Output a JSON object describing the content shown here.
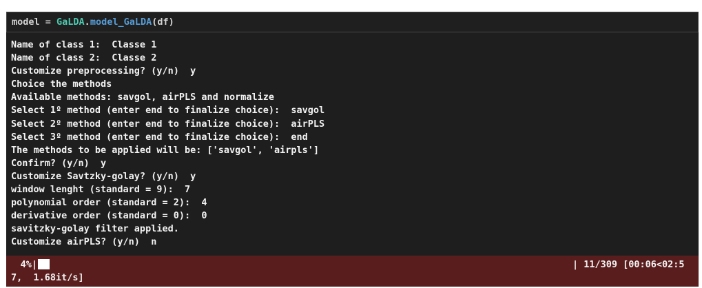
{
  "cell": {
    "code": {
      "var": "model",
      "op": " = ",
      "module": "GaLDA",
      "dot": ".",
      "func": "model_GaLDA",
      "args": "(df)"
    }
  },
  "output": {
    "lines": [
      "Name of class 1:  Classe 1",
      "Name of class 2:  Classe 2",
      "Customize preprocessing? (y/n)  y",
      "Choice the methods",
      "Available methods: savgol, airPLS and normalize",
      "Select 1º method (enter end to finalize choice):  savgol",
      "Select 2º method (enter end to finalize choice):  airPLS",
      "Select 3º method (enter end to finalize choice):  end",
      "The methods to be applied will be: ['savgol', 'airpls']",
      "Confirm? (y/n)  y",
      "Customize Savtzky-golay? (y/n)  y",
      "window lenght (standard = 9):  7",
      "polynomial order (standard = 2):  4",
      "derivative order (standard = 0):  0",
      "savitzky-golay filter applied.",
      "Customize airPLS? (y/n)  n"
    ]
  },
  "progress": {
    "percent_text": "4%|",
    "fraction": 0.04,
    "stats_right": "| 11/309 [00:06<02:5",
    "stats_wrap": "7,  1.68it/s]"
  },
  "colors": {
    "background": "#1e1e1e",
    "stderr_background": "#5a1d1d",
    "module_color": "#4ec9b0",
    "function_color": "#569cd6",
    "text": "#f2f2f2"
  }
}
